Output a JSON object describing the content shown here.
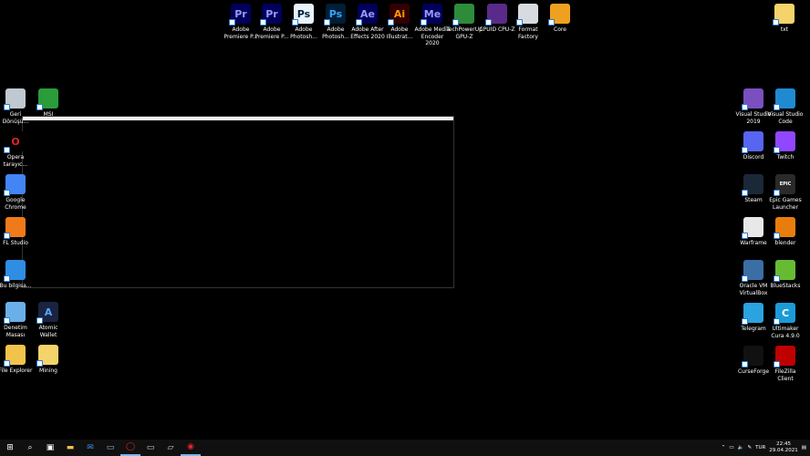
{
  "top_icons": [
    {
      "label": "Adobe Premiere P...",
      "icon": "premiere-icon",
      "glyph": "Pr",
      "color": "#00005b",
      "fg": "#9999ff"
    },
    {
      "label": "Adobe Premiere P...",
      "icon": "premiere-icon",
      "glyph": "Pr",
      "color": "#00005b",
      "fg": "#9999ff"
    },
    {
      "label": "Adobe Photosh...",
      "icon": "photoshop-icon",
      "glyph": "Ps",
      "color": "#e8f4fc",
      "fg": "#001e36"
    },
    {
      "label": "Adobe Photosh...",
      "icon": "photoshop-icon",
      "glyph": "Ps",
      "color": "#001e36",
      "fg": "#31a8ff"
    },
    {
      "label": "Adobe After Effects 2020",
      "icon": "after-effects-icon",
      "glyph": "Ae",
      "color": "#00005b",
      "fg": "#9999ff"
    },
    {
      "label": "Adobe Illustrat...",
      "icon": "illustrator-icon",
      "glyph": "Ai",
      "color": "#330000",
      "fg": "#ff9a00"
    },
    {
      "label": "Adobe Media Encoder 2020",
      "icon": "media-encoder-icon",
      "glyph": "Me",
      "color": "#00005b",
      "fg": "#9999ff"
    },
    {
      "label": "TechPowerUp GPU-Z",
      "icon": "gpu-z-icon",
      "glyph": "",
      "color": "#2e8b3a",
      "fg": "#fff"
    },
    {
      "label": "CPUID CPU-Z",
      "icon": "cpu-z-icon",
      "glyph": "",
      "color": "#5a2a8a",
      "fg": "#fff"
    },
    {
      "label": "Format Factory",
      "icon": "format-factory-icon",
      "glyph": "",
      "color": "#d7dbe0",
      "fg": "#333"
    },
    {
      "label": "Core",
      "icon": "core-icon",
      "glyph": "",
      "color": "#f0a020",
      "fg": "#fff"
    }
  ],
  "right_top_icon": {
    "label": "txt",
    "icon": "folder-icon",
    "color": "#f5d36b"
  },
  "left_icons": [
    {
      "label": "Geri Dönüşü...",
      "icon": "recycle-bin-icon",
      "glyph": "",
      "color": "#c0c8d0"
    },
    {
      "label": "MSI",
      "icon": "msi-icon",
      "glyph": "",
      "color": "#2a9d3a"
    },
    {
      "label": "Opera tarayıc...",
      "icon": "opera-icon",
      "glyph": "O",
      "color": "#000",
      "fg": "#e4222a"
    },
    {
      "label": "Google Chrome",
      "icon": "chrome-icon",
      "glyph": "",
      "color": "#4285f4"
    },
    {
      "label": "FL Studio",
      "icon": "fl-studio-icon",
      "glyph": "",
      "color": "#f07a1a"
    },
    {
      "label": "Bu bilgisa...",
      "icon": "this-pc-icon",
      "glyph": "",
      "color": "#2f8de4"
    },
    {
      "label": "Denetim Masası",
      "icon": "control-panel-icon",
      "glyph": "",
      "color": "#6ab0e8"
    },
    {
      "label": "Atomic Wallet",
      "icon": "atomic-wallet-icon",
      "glyph": "A",
      "color": "#1a2440",
      "fg": "#58a6ff"
    },
    {
      "label": "File Explorer",
      "icon": "file-explorer-icon",
      "glyph": "",
      "color": "#f2c34b"
    },
    {
      "label": "Mining",
      "icon": "folder-icon",
      "glyph": "",
      "color": "#f5d36b"
    }
  ],
  "right_icons": [
    {
      "label": "Visual Studio 2019",
      "icon": "visual-studio-icon",
      "glyph": "",
      "color": "#7a4fc0"
    },
    {
      "label": "Visual Studio Code",
      "icon": "vscode-icon",
      "glyph": "",
      "color": "#1f8ad2"
    },
    {
      "label": "Discord",
      "icon": "discord-icon",
      "glyph": "",
      "color": "#5865f2"
    },
    {
      "label": "Twitch",
      "icon": "twitch-icon",
      "glyph": "",
      "color": "#9146ff"
    },
    {
      "label": "Steam",
      "icon": "steam-icon",
      "glyph": "",
      "color": "#1b2838"
    },
    {
      "label": "Epic Games Launcher",
      "icon": "epic-games-icon",
      "glyph": "EPIC",
      "color": "#2a2a2a",
      "fg": "#fff"
    },
    {
      "label": "Warframe",
      "icon": "warframe-icon",
      "glyph": "",
      "color": "#e8e8e8"
    },
    {
      "label": "blender",
      "icon": "blender-icon",
      "glyph": "",
      "color": "#e87d0d"
    },
    {
      "label": "Oracle VM VirtualBox",
      "icon": "virtualbox-icon",
      "glyph": "",
      "color": "#3a6ea5"
    },
    {
      "label": "BlueStacks",
      "icon": "bluestacks-icon",
      "glyph": "",
      "color": "#66bb33"
    },
    {
      "label": "Telegram",
      "icon": "telegram-icon",
      "glyph": "",
      "color": "#2aa3e0"
    },
    {
      "label": "Ultimaker Cura 4.9.0",
      "icon": "cura-icon",
      "glyph": "C",
      "color": "#1a9bd7",
      "fg": "#fff"
    },
    {
      "label": "CurseForge",
      "icon": "curseforge-icon",
      "glyph": "",
      "color": "#111"
    },
    {
      "label": "FileZilla Client",
      "icon": "filezilla-icon",
      "glyph": "",
      "color": "#bf0000"
    }
  ],
  "taskbar": {
    "items": [
      {
        "icon": "windows-start-icon",
        "color": "#fff"
      },
      {
        "icon": "search-icon",
        "color": "#fff"
      },
      {
        "icon": "task-view-icon",
        "color": "#fff"
      },
      {
        "icon": "file-explorer-icon",
        "color": "#f2c34b"
      },
      {
        "icon": "mail-icon",
        "color": "#3a8ee6"
      },
      {
        "icon": "remote-desktop-icon",
        "color": "#8fb4e6"
      },
      {
        "icon": "opera-icon",
        "color": "#e4222a"
      },
      {
        "icon": "terminal-icon",
        "color": "#cfcfcf"
      },
      {
        "icon": "ssh-icon",
        "color": "#cfcfcf"
      },
      {
        "icon": "record-icon",
        "color": "#e4222a"
      }
    ],
    "language": "TUR",
    "time": "22:45",
    "date": "29.04.2021"
  }
}
